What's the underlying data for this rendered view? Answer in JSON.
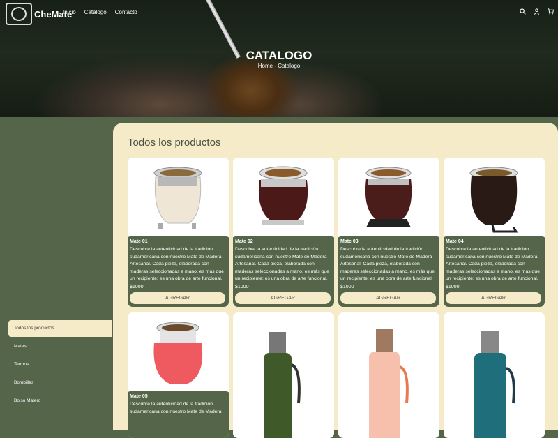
{
  "brand": {
    "name": "CheMate"
  },
  "nav": {
    "items": [
      "Inicio",
      "Catalogo",
      "Contacto"
    ]
  },
  "icons": {
    "search": "search-icon",
    "user": "user-icon",
    "cart": "cart-icon"
  },
  "hero": {
    "title": "CATALOGO",
    "breadcrumb": "Home - Catalogo"
  },
  "sidebar": {
    "items": [
      "Todos los productos",
      "Mates",
      "Termos",
      "Bombillas",
      "Bolso Matero"
    ],
    "active": "Todos los productos"
  },
  "main": {
    "title": "Todos los productos"
  },
  "products": [
    {
      "name": "Mate 01",
      "description": "Descubre la autenticidad de la tradición sudamericana con nuestro Mate de Madera Artesanal. Cada pieza, elaborada con maderas seleccionadas a mano, es más que un recipiente; es una obra de arte funcional.",
      "price": "$1000",
      "button": "AGREGAR"
    },
    {
      "name": "Mate 02",
      "description": "Descubre la autenticidad de la tradición sudamericana con nuestro Mate de Madera Artesanal. Cada pieza, elaborada con maderas seleccionadas a mano, es más que un recipiente; es una obra de arte funcional.",
      "price": "$1000",
      "button": "AGREGAR"
    },
    {
      "name": "Mate 03",
      "description": "Descubre la autenticidad de la tradición sudamericana con nuestro Mate de Madera Artesanal. Cada pieza, elaborada con maderas seleccionadas a mano, es más que un recipiente; es una obra de arte funcional.",
      "price": "$1000",
      "button": "AGREGAR"
    },
    {
      "name": "Mate 04",
      "description": "Descubre la autenticidad de la tradición sudamericana con nuestro Mate de Madera Artesanal. Cada pieza, elaborada con maderas seleccionadas a mano, es más que un recipiente; es una obra de arte funcional.",
      "price": "$1000",
      "button": "AGREGAR"
    },
    {
      "name": "Mate 05",
      "description": "Descubre la autenticidad de la tradición sudamericana con nuestro Mate de Madera",
      "price": "",
      "button": ""
    }
  ],
  "colors": {
    "green": "#55654a",
    "cream": "#f6ebc8"
  }
}
